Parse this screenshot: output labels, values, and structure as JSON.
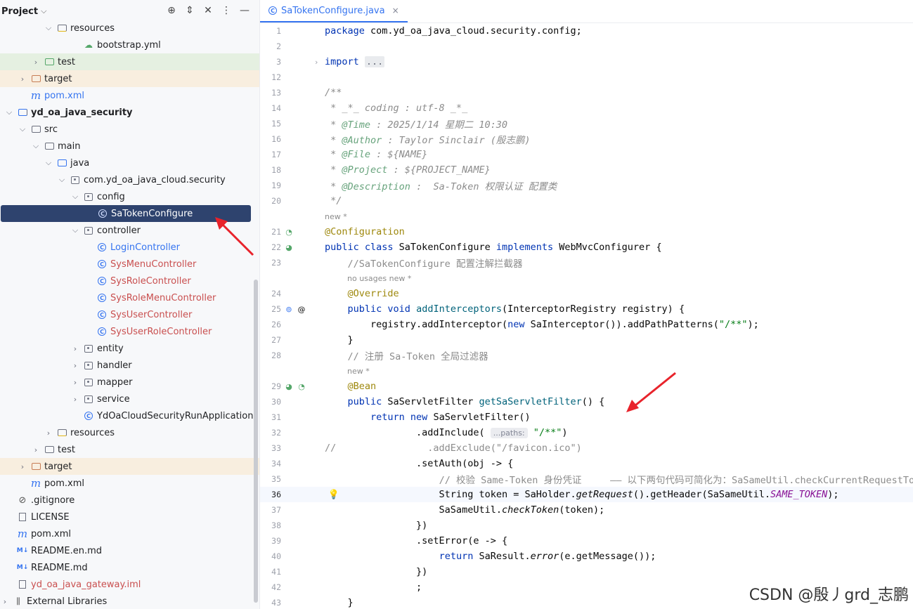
{
  "project_panel": {
    "title": "Project",
    "header_icons": [
      "crosshair-icon",
      "expand-icon",
      "collapse-icon",
      "more-icon",
      "minimize-icon"
    ],
    "tree": [
      {
        "label": "resources",
        "icon": "folder-resources",
        "chevron": "down",
        "indent": 80,
        "bg": "",
        "color": ""
      },
      {
        "label": "bootstrap.yml",
        "icon": "yml",
        "chevron": "",
        "indent": 118,
        "bg": "",
        "color": ""
      },
      {
        "label": "test",
        "icon": "folder-green",
        "chevron": "right",
        "indent": 62,
        "bg": "green-bg",
        "color": ""
      },
      {
        "label": "target",
        "icon": "folder-orange",
        "chevron": "right",
        "indent": 43,
        "bg": "orange-bg",
        "color": ""
      },
      {
        "label": "pom.xml",
        "icon": "maven",
        "chevron": "",
        "indent": 43,
        "bg": "",
        "color": "blue"
      },
      {
        "label": "yd_oa_java_security",
        "icon": "module",
        "chevron": "down",
        "indent": 24,
        "bg": "",
        "color": "bold"
      },
      {
        "label": "src",
        "icon": "folder",
        "chevron": "down",
        "indent": 43,
        "bg": "",
        "color": ""
      },
      {
        "label": "main",
        "icon": "folder",
        "chevron": "down",
        "indent": 62,
        "bg": "",
        "color": ""
      },
      {
        "label": "java",
        "icon": "folder-blue",
        "chevron": "down",
        "indent": 80,
        "bg": "",
        "color": ""
      },
      {
        "label": "com.yd_oa_java_cloud.security",
        "icon": "package",
        "chevron": "down",
        "indent": 99,
        "bg": "",
        "color": ""
      },
      {
        "label": "config",
        "icon": "package",
        "chevron": "down",
        "indent": 118,
        "bg": "",
        "color": ""
      },
      {
        "label": "SaTokenConfigure",
        "icon": "class",
        "chevron": "",
        "indent": 137,
        "bg": "selected",
        "color": ""
      },
      {
        "label": "controller",
        "icon": "package",
        "chevron": "down",
        "indent": 118,
        "bg": "",
        "color": ""
      },
      {
        "label": "LoginController",
        "icon": "class",
        "chevron": "",
        "indent": 137,
        "bg": "",
        "color": "blue"
      },
      {
        "label": "SysMenuController",
        "icon": "class",
        "chevron": "",
        "indent": 137,
        "bg": "",
        "color": "red"
      },
      {
        "label": "SysRoleController",
        "icon": "class",
        "chevron": "",
        "indent": 137,
        "bg": "",
        "color": "red"
      },
      {
        "label": "SysRoleMenuController",
        "icon": "class",
        "chevron": "",
        "indent": 137,
        "bg": "",
        "color": "red"
      },
      {
        "label": "SysUserController",
        "icon": "class",
        "chevron": "",
        "indent": 137,
        "bg": "",
        "color": "red"
      },
      {
        "label": "SysUserRoleController",
        "icon": "class",
        "chevron": "",
        "indent": 137,
        "bg": "",
        "color": "red"
      },
      {
        "label": "entity",
        "icon": "package",
        "chevron": "right",
        "indent": 118,
        "bg": "",
        "color": ""
      },
      {
        "label": "handler",
        "icon": "package",
        "chevron": "right",
        "indent": 118,
        "bg": "",
        "color": ""
      },
      {
        "label": "mapper",
        "icon": "package",
        "chevron": "right",
        "indent": 118,
        "bg": "",
        "color": ""
      },
      {
        "label": "service",
        "icon": "package",
        "chevron": "right",
        "indent": 118,
        "bg": "",
        "color": ""
      },
      {
        "label": "YdOaCloudSecurityRunApplication",
        "icon": "app-class",
        "chevron": "",
        "indent": 118,
        "bg": "",
        "color": ""
      },
      {
        "label": "resources",
        "icon": "folder-resources",
        "chevron": "right",
        "indent": 80,
        "bg": "",
        "color": ""
      },
      {
        "label": "test",
        "icon": "folder",
        "chevron": "right",
        "indent": 62,
        "bg": "",
        "color": ""
      },
      {
        "label": "target",
        "icon": "folder-orange",
        "chevron": "right",
        "indent": 43,
        "bg": "orange-bg",
        "color": ""
      },
      {
        "label": "pom.xml",
        "icon": "maven",
        "chevron": "",
        "indent": 43,
        "bg": "",
        "color": ""
      },
      {
        "label": ".gitignore",
        "icon": "gitignore",
        "chevron": "",
        "indent": 24,
        "bg": "",
        "color": ""
      },
      {
        "label": "LICENSE",
        "icon": "text-file",
        "chevron": "",
        "indent": 24,
        "bg": "",
        "color": ""
      },
      {
        "label": "pom.xml",
        "icon": "maven",
        "chevron": "",
        "indent": 24,
        "bg": "",
        "color": ""
      },
      {
        "label": "README.en.md",
        "icon": "markdown",
        "chevron": "",
        "indent": 24,
        "bg": "",
        "color": ""
      },
      {
        "label": "README.md",
        "icon": "markdown",
        "chevron": "",
        "indent": 24,
        "bg": "",
        "color": ""
      },
      {
        "label": "yd_oa_java_gateway.iml",
        "icon": "iml",
        "chevron": "",
        "indent": 24,
        "bg": "",
        "color": "red"
      },
      {
        "label": "External Libraries",
        "icon": "libraries",
        "chevron": "right",
        "indent": 6,
        "bg": "",
        "color": ""
      }
    ]
  },
  "editor": {
    "tab": {
      "label": "SaTokenConfigure.java",
      "close": "×"
    },
    "lines": [
      {
        "n": "1",
        "kind": "code",
        "html": "<span class='kw'>package</span> com.yd_oa_java_cloud.security.config;"
      },
      {
        "n": "2",
        "kind": "code",
        "html": ""
      },
      {
        "n": "3",
        "kind": "code",
        "html": "<span class='kw'>import</span> <span class='fold-box'>...</span>",
        "fold": "›"
      },
      {
        "n": "12",
        "kind": "code",
        "html": ""
      },
      {
        "n": "13",
        "kind": "code",
        "html": "<span class='doc'>/**</span>"
      },
      {
        "n": "14",
        "kind": "code",
        "html": "<span class='doc'> * _*_ coding : utf-8 _*_</span>"
      },
      {
        "n": "15",
        "kind": "code",
        "html": "<span class='doc'> * </span><span class='doc-tag'>@Time</span><span class='doc'> : 2025/1/14 星期二 10:30</span>"
      },
      {
        "n": "16",
        "kind": "code",
        "html": "<span class='doc'> * </span><span class='doc-tag'>@Author</span><span class='doc'> : Taylor Sinclair (殷志鹏)</span>"
      },
      {
        "n": "17",
        "kind": "code",
        "html": "<span class='doc'> * </span><span class='doc-tag'>@File</span><span class='doc'> : ${NAME}</span>"
      },
      {
        "n": "18",
        "kind": "code",
        "html": "<span class='doc'> * </span><span class='doc-tag'>@Project</span><span class='doc'> : ${PROJECT_NAME}</span>"
      },
      {
        "n": "19",
        "kind": "code",
        "html": "<span class='doc'> * </span><span class='doc-tag'>@Description</span><span class='doc'> :  Sa-Token 权限认证 配置类</span>"
      },
      {
        "n": "20",
        "kind": "code",
        "html": "<span class='doc'> */</span>"
      },
      {
        "n": "",
        "kind": "hint",
        "text": "new *"
      },
      {
        "n": "21",
        "kind": "code",
        "html": "<span class='ann'>@Configuration</span>",
        "gutter": [
          "leaf"
        ]
      },
      {
        "n": "22",
        "kind": "code",
        "html": "<span class='kw'>public class</span> SaTokenConfigure <span class='kw'>implements</span> WebMvcConfigurer {",
        "gutter": [
          "leaf-search"
        ]
      },
      {
        "n": "23",
        "kind": "code",
        "html": "    <span class='cm'>//SaTokenConfigure 配置注解拦截器</span>"
      },
      {
        "n": "",
        "kind": "hint",
        "text": "no usages   new *",
        "offset": 32
      },
      {
        "n": "24",
        "kind": "code",
        "html": "    <span class='ann'>@Override</span>"
      },
      {
        "n": "25",
        "kind": "code",
        "html": "    <span class='kw'>public void</span> <span class='fn'>addInterceptors</span>(InterceptorRegistry registry) {",
        "gutter": [
          "override",
          "at"
        ]
      },
      {
        "n": "26",
        "kind": "code",
        "html": "        registry.addInterceptor(<span class='kw'>new</span> SaInterceptor()).addPathPatterns(<span class='str'>\"/**\"</span>);"
      },
      {
        "n": "27",
        "kind": "code",
        "html": "    }"
      },
      {
        "n": "28",
        "kind": "code",
        "html": "    <span class='cm'>// 注册 Sa-Token 全局过滤器</span>"
      },
      {
        "n": "",
        "kind": "hint",
        "text": "new *",
        "offset": 32
      },
      {
        "n": "29",
        "kind": "code",
        "html": "    <span class='ann'>@Bean</span>",
        "gutter": [
          "leaf-search",
          "leaf"
        ]
      },
      {
        "n": "30",
        "kind": "code",
        "html": "    <span class='kw'>public</span> SaServletFilter <span class='fn'>getSaServletFilter</span>() {"
      },
      {
        "n": "31",
        "kind": "code",
        "html": "        <span class='kw'>return new</span> SaServletFilter()"
      },
      {
        "n": "32",
        "kind": "code",
        "html": "                .addInclude( <span class='param-hint'>...paths:</span> <span class='str'>\"/**\"</span>)"
      },
      {
        "n": "33",
        "kind": "code",
        "html": "<span class='cm'>//                .addExclude(\"/favicon.ico\")</span>"
      },
      {
        "n": "34",
        "kind": "code",
        "html": "                .setAuth(obj -> {"
      },
      {
        "n": "35",
        "kind": "code",
        "html": "                    <span class='cm'>// 校验 Same-Token 身份凭证     —— 以下两句代码可简化为：SaSameUtil.checkCurrentRequestToken();</span>"
      },
      {
        "n": "36",
        "kind": "code",
        "html": "                    String token = SaHolder.<span class='ital'>getRequest</span>().getHeader(SaSameUtil.<span class='const'>SAME_TOKEN</span>);",
        "current": true,
        "gutter": [
          "bulb"
        ]
      },
      {
        "n": "37",
        "kind": "code",
        "html": "                    SaSameUtil.<span class='ital'>checkToken</span>(token);"
      },
      {
        "n": "38",
        "kind": "code",
        "html": "                })"
      },
      {
        "n": "39",
        "kind": "code",
        "html": "                .setError(e -> {"
      },
      {
        "n": "40",
        "kind": "code",
        "html": "                    <span class='kw'>return</span> SaResult.<span class='ital'>error</span>(e.getMessage());"
      },
      {
        "n": "41",
        "kind": "code",
        "html": "                })"
      },
      {
        "n": "42",
        "kind": "code",
        "html": "                ;"
      },
      {
        "n": "43",
        "kind": "code",
        "html": "    }"
      }
    ]
  },
  "watermark": "CSDN @殷丿grd_志鹏"
}
